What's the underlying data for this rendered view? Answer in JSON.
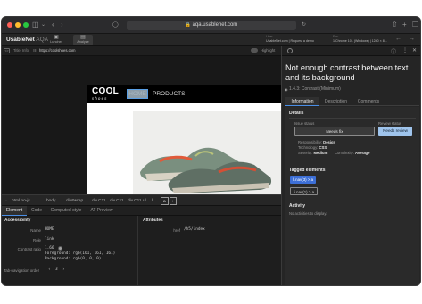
{
  "safari": {
    "url": "aqa.usablenet.com"
  },
  "app": {
    "brand": "UsableNet",
    "brand_suffix": "AQA",
    "toolbar": [
      {
        "label": "Luncher",
        "icon": "launcher-icon"
      },
      {
        "label": "Analyze",
        "icon": "analyze-icon"
      }
    ],
    "user_label": "User",
    "user_value": "UsableNet.com | Request a demo",
    "env_label": "Env",
    "env_value": "1 Chrome 101 (Windows) | 1280 × 8..."
  },
  "urlrow": {
    "title_label": "Title",
    "title_value": "Info",
    "url": "https://coolshoes.com",
    "highlight": "Highlight"
  },
  "site": {
    "logo_line1": "COOL",
    "logo_line2": "shoes",
    "nav_home": "HOME",
    "nav_products": "PRODUCTS"
  },
  "breadcrumbs": [
    "html.no-js",
    "body",
    "div#wrap",
    "div.C11",
    "div.C11",
    "div.C11",
    "ul",
    "li",
    "a"
  ],
  "devtools_tabs": [
    "Element",
    "Code",
    "Computed style",
    "AT Preview"
  ],
  "accessibility": {
    "heading": "Accessibility",
    "name_label": "Name",
    "name_value": "HOME",
    "role_label": "Role",
    "role_value": "link",
    "contrast_label": "Contrast ratio",
    "contrast_value": "1.66",
    "foreground": "Foreground: rgb(161, 161, 161)",
    "background": "Background: rgb(0, 0, 0)",
    "tab_label": "Tab-navigation order",
    "tab_value": "3"
  },
  "attributes": {
    "heading": "Attributes",
    "href_label": "href",
    "href_value": "/h5/index"
  },
  "issue": {
    "title": "Not enough contrast between text and its background",
    "criterion": "1.4.3: Contrast (Minimum)",
    "tabs": [
      "Information",
      "Description",
      "Comments"
    ],
    "details_heading": "Details",
    "issue_status_label": "Issue status",
    "issue_status_value": "Needs fix",
    "review_status_label": "Review status",
    "review_status_value": "Needs review",
    "responsibility_label": "Responsibility:",
    "responsibility_value": "Design",
    "technology_label": "Technology:",
    "technology_value": "CSS",
    "severity_label": "Severity:",
    "severity_value": "Medium",
    "complexity_label": "Complexity:",
    "complexity_value": "Average",
    "tagged_heading": "Tagged elements",
    "tagged": [
      "li.nav(3) > a",
      "li.nav(1) > a"
    ],
    "activity_heading": "Activity",
    "activity_text": "No activities to display."
  },
  "colors": {
    "accent": "#4a8ee6",
    "review": "#9fc4ec",
    "chip_active": "#3d6fd6"
  }
}
